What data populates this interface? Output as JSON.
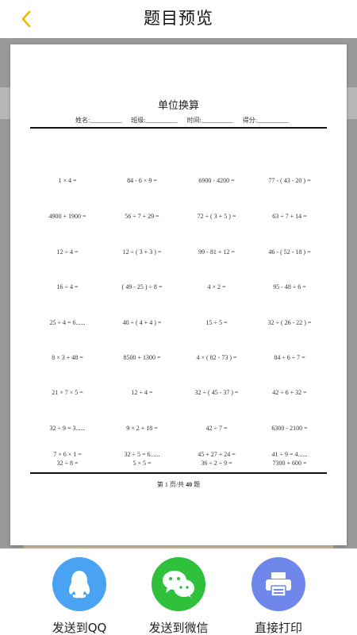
{
  "header": {
    "title": "题目预览"
  },
  "sheet": {
    "title": "单位换算",
    "info": {
      "name": "姓名:__________",
      "class": "班级:__________",
      "time": "时间:__________",
      "score": "得分:__________"
    },
    "rows": [
      [
        "1 × 4 =",
        "84 - 6 × 9 =",
        "6900 - 4200 =",
        "77 - ( 43 - 20 ) ="
      ],
      [
        "4900 + 1900 =",
        "56 ÷ 7 + 29 =",
        "72 ÷ ( 3 + 5 ) =",
        "63 ÷ 7 + 14 ="
      ],
      [
        "12 ÷ 4 =",
        "12 ÷ ( 3 + 3 ) =",
        "99 - 81 + 12 =",
        "46 - ( 52 - 18 ) ="
      ],
      [
        "16 ÷ 4 =",
        "( 49 - 25 ) ÷ 8 =",
        "4 × 2 =",
        "95 - 48 ÷ 6 ="
      ],
      [
        "25 ÷ 4 = 6......",
        "40 ÷ ( 4 + 4 ) =",
        "15 ÷ 5 =",
        "32 ÷ ( 26 - 22 ) ="
      ],
      [
        "8 × 3 + 48 =",
        "8500 + 1300 =",
        "4 × ( 82 - 73 ) =",
        "84 ÷ 6 ÷ 7 ="
      ],
      [
        "21 × 7 × 5 =",
        "12 ÷ 4 =",
        "32 ÷ ( 45 - 37 ) =",
        "42 ÷ 6 + 32 ="
      ],
      [
        "32 ÷ 9 = 3......",
        "9 × 2 + 18 =",
        "42 ÷ 7 =",
        "6300 - 2100 ="
      ],
      [
        "32 ÷ 8 =",
        "5 × 5 =",
        "36 ÷ 2 ÷ 9 =",
        "7300 + 600 ="
      ],
      [
        "7 × 6 × 1 =",
        "32 ÷ 5 = 6......",
        "45 + 27 + 24 =",
        "41 ÷ 9 = 4......"
      ]
    ],
    "footer": {
      "prefix": "第 1 页/共 ",
      "total": "40",
      "suffix": " 题"
    }
  },
  "actions": {
    "qq": {
      "label": "发送到QQ",
      "icon": "qq-penguin-icon",
      "color": "#4aa3f2"
    },
    "wechat": {
      "label": "发送到微信",
      "icon": "wechat-icon",
      "color": "#2fc13c"
    },
    "print": {
      "label": "直接打印",
      "icon": "printer-icon",
      "color": "#6f87ea"
    }
  },
  "colors": {
    "back_arrow": "#f2b705"
  }
}
